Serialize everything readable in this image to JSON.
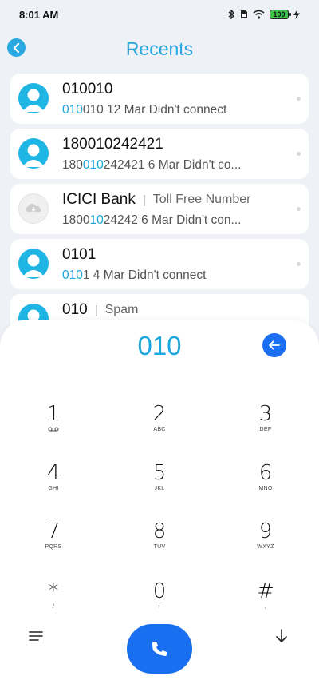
{
  "status_bar": {
    "time": "8:01 AM",
    "battery": "100",
    "icons": [
      "bluetooth-icon",
      "sim-icon",
      "wifi-icon",
      "battery-icon",
      "charging-icon"
    ]
  },
  "header": {
    "title": "Recents"
  },
  "recents": [
    {
      "name": "010010",
      "tag": "",
      "detail_match": "010",
      "detail_rest": "010 12 Mar Didn't connect",
      "detail_prefix": "",
      "avatar": "person"
    },
    {
      "name": "180010242421",
      "tag": "",
      "detail_prefix": "180",
      "detail_match": "010",
      "detail_rest": "242421 6 Mar Didn't co...",
      "avatar": "person"
    },
    {
      "name": "ICICI Bank",
      "tag": "Toll Free Number",
      "detail_prefix": "1800",
      "detail_match": "10",
      "detail_rest": "24242 6 Mar Didn't con...",
      "avatar": "cloud"
    },
    {
      "name": "0101",
      "tag": "",
      "detail_prefix": "",
      "detail_match": "010",
      "detail_rest": "1 4 Mar Didn't connect",
      "avatar": "person"
    },
    {
      "name": "010",
      "tag": "Spam",
      "detail_prefix": "",
      "detail_match": "",
      "detail_rest": "",
      "avatar": "person"
    }
  ],
  "dialer": {
    "input": "010",
    "keys": [
      {
        "digit": "1",
        "letters": ""
      },
      {
        "digit": "2",
        "letters": "ABC"
      },
      {
        "digit": "3",
        "letters": "DEF"
      },
      {
        "digit": "4",
        "letters": "GHI"
      },
      {
        "digit": "5",
        "letters": "JKL"
      },
      {
        "digit": "6",
        "letters": "MNO"
      },
      {
        "digit": "7",
        "letters": "PQRS"
      },
      {
        "digit": "8",
        "letters": "TUV"
      },
      {
        "digit": "9",
        "letters": "WXYZ"
      },
      {
        "digit": "*",
        "letters": "/"
      },
      {
        "digit": "0",
        "letters": "+"
      },
      {
        "digit": "#",
        "letters": ","
      }
    ]
  },
  "colors": {
    "accent": "#27a7e0",
    "call": "#1a6ff0",
    "avatar": "#1fb6e6"
  }
}
